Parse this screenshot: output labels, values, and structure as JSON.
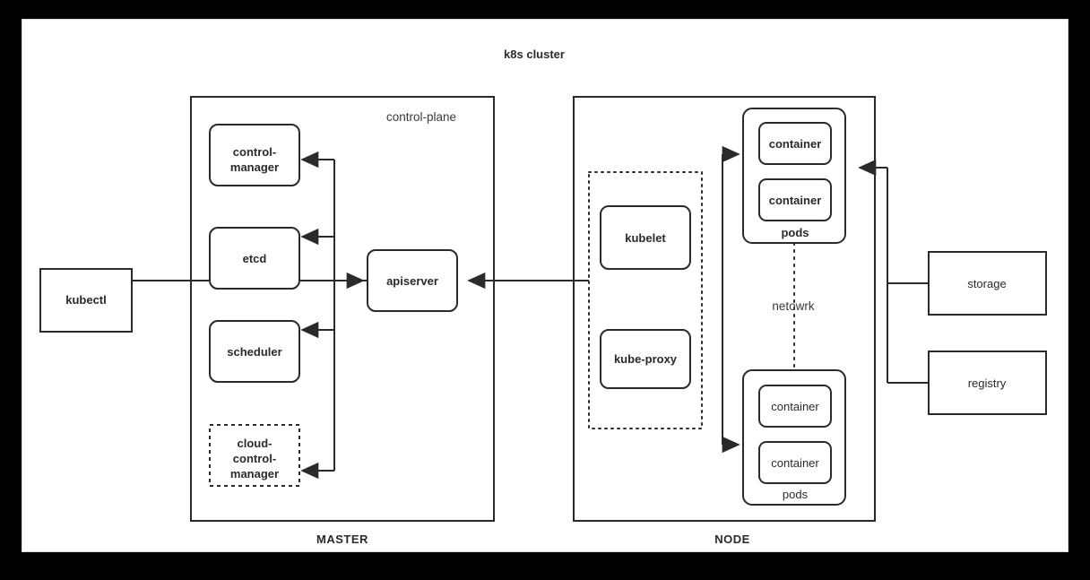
{
  "diagram": {
    "title": "k8s cluster",
    "frame_color": "#000000",
    "canvas_color": "#ffffff",
    "stroke_color": "#2a2a2a",
    "captions": {
      "master": "MASTER",
      "node": "NODE"
    },
    "groups": {
      "control_plane": "control-plane",
      "network_label": "netowrk"
    },
    "master": {
      "control_manager": {
        "line1": "control-",
        "line2": "manager"
      },
      "etcd": "etcd",
      "scheduler": "scheduler",
      "cloud_control_manager": {
        "line1": "cloud-",
        "line2": "control-",
        "line3": "manager"
      },
      "apiserver": "apiserver"
    },
    "client": {
      "kubectl": "kubectl"
    },
    "node": {
      "kubelet": "kubelet",
      "kube_proxy": "kube-proxy",
      "pods_top": {
        "label": "pods",
        "containers": [
          "container",
          "container"
        ]
      },
      "pods_bottom": {
        "label": "pods",
        "containers": [
          "container",
          "container"
        ]
      }
    },
    "external": {
      "storage": "storage",
      "registry": "registry"
    }
  }
}
